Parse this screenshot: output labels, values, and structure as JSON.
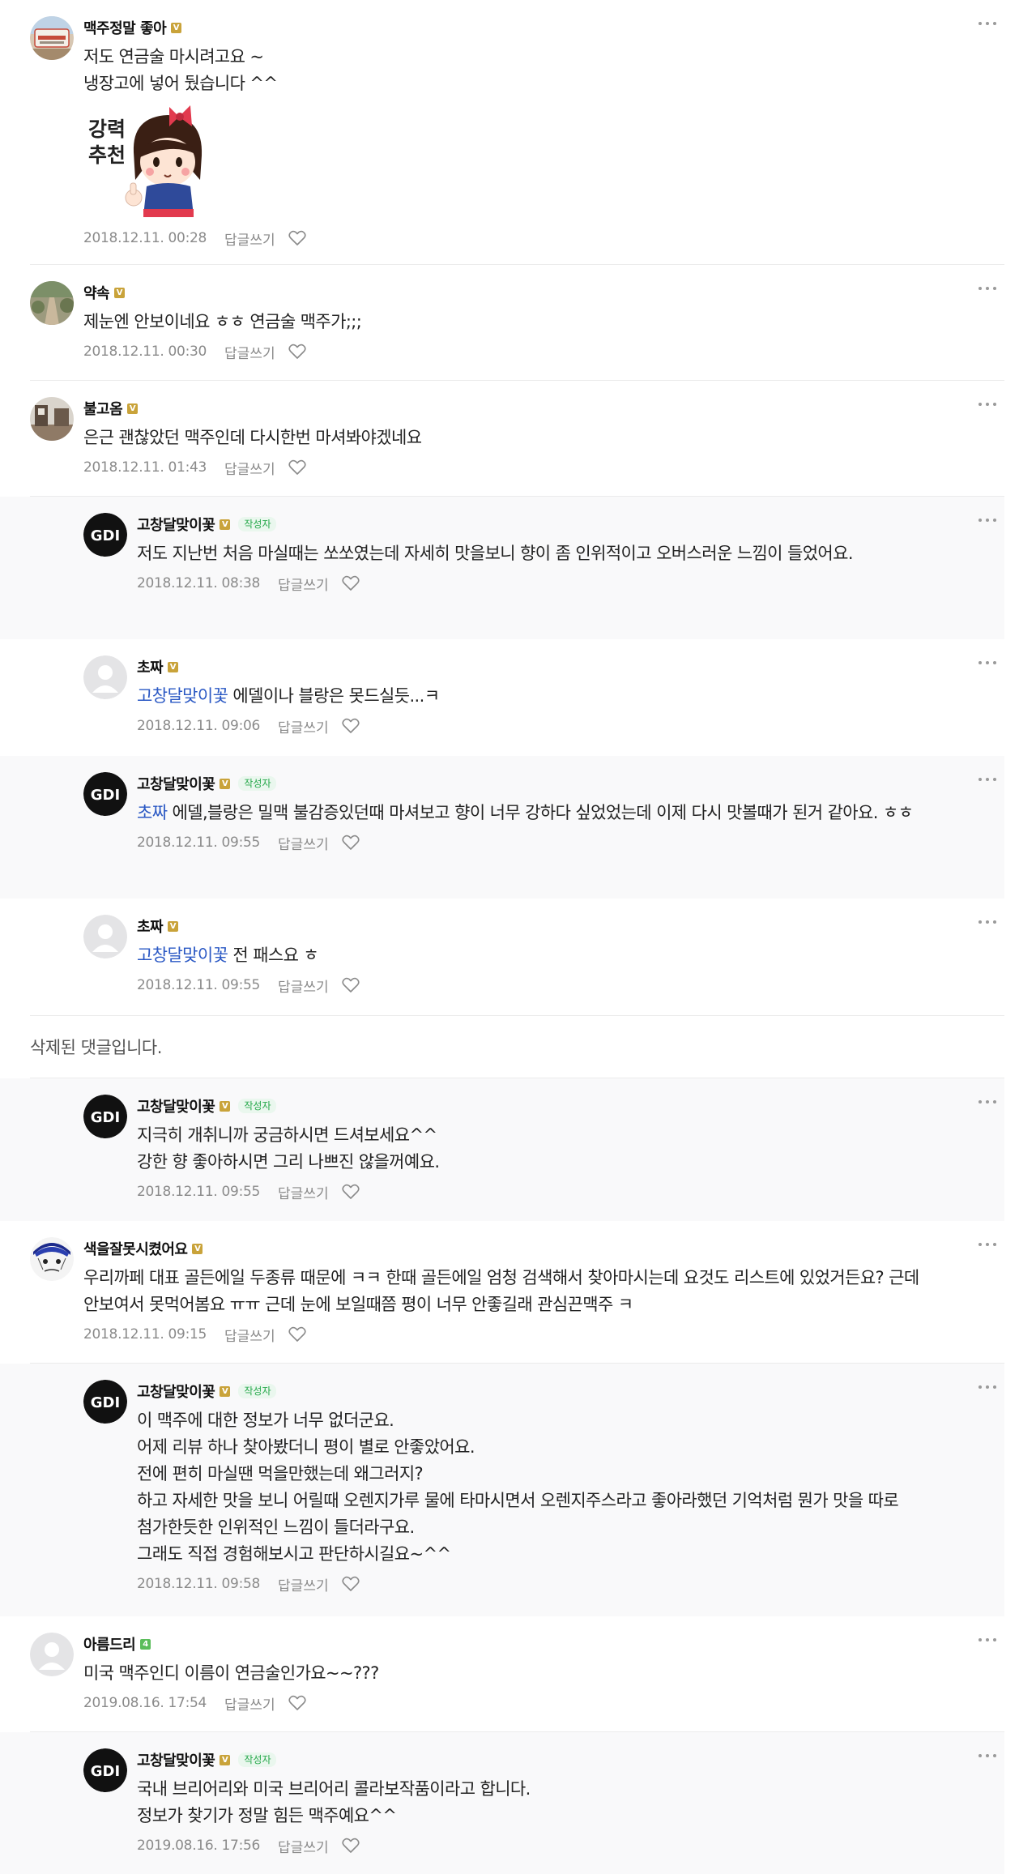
{
  "labels": {
    "reply": "답글쓰기",
    "author_badge": "작성자",
    "more_icon": "more-icon",
    "like_icon": "heart-icon"
  },
  "colors": {
    "grade_gold": "#c9a33a",
    "grade_green": "#5bbd5b",
    "mention": "#2a58c4",
    "reply_bg": "#f9f9fa",
    "author_badge": "#25a84a"
  },
  "sticker": {
    "text_line1": "강력",
    "text_line2": "추천"
  },
  "comments": [
    {
      "nick": "맥주정말 좋아",
      "grade": "V",
      "text": "저도 연금술 마시려고요 ~\n냉장고에 넣어 뒀습니다 ^^",
      "date": "2018.12.11. 00:28",
      "avatar": "brewery-sign"
    },
    {
      "nick": "약속",
      "grade": "V",
      "text": "제눈엔 안보이네요 ㅎㅎ 연금술 맥주가;;;",
      "date": "2018.12.11. 00:30",
      "avatar": "path-photo"
    },
    {
      "nick": "불고옴",
      "grade": "V",
      "text": "은근 괜찮았던 맥주인데 다시한번 마셔봐야겠네요",
      "date": "2018.12.11. 01:43",
      "avatar": "room-photo"
    },
    {
      "nick": "고창달맞이꽃",
      "grade": "V",
      "author": true,
      "text": "저도 지난번 처음 마실때는 쏘쏘였는데 자세히 맛을보니 향이 좀 인위적이고 오버스러운 느낌이 들었어요.",
      "date": "2018.12.11. 08:38",
      "avatar": "logo"
    },
    {
      "nick": "초짜",
      "grade": "V",
      "mention": "고창달맞이꽃",
      "text": " 에델이나 블랑은 못드실듯...ㅋ",
      "date": "2018.12.11. 09:06",
      "avatar": "default"
    },
    {
      "nick": "고창달맞이꽃",
      "grade": "V",
      "author": true,
      "mention": "초짜",
      "text": " 에델,블랑은 밀맥 불감증있던때 마셔보고 향이 너무 강하다 싶었었는데 이제 다시 맛볼때가 된거 같아요. ㅎㅎ",
      "date": "2018.12.11. 09:55",
      "avatar": "logo"
    },
    {
      "nick": "초짜",
      "grade": "V",
      "mention": "고창달맞이꽃",
      "text": " 전 패스요 ㅎ",
      "date": "2018.12.11. 09:55",
      "avatar": "default"
    },
    {
      "deleted_text": "삭제된 댓글입니다."
    },
    {
      "nick": "고창달맞이꽃",
      "grade": "V",
      "author": true,
      "text": "지극히 개취니까 궁금하시면 드셔보세요^^\n강한 향 좋아하시면 그리 나쁘진 않을꺼예요.",
      "date": "2018.12.11. 09:55",
      "avatar": "logo"
    },
    {
      "nick": "색을잘못시켰어요",
      "grade": "V",
      "text": "우리까페 대표 골든에일 두종류 때문에 ㅋㅋ 한때 골든에일 엄청 검색해서 찾아마시는데 요것도 리스트에 있었거든요? 근데 안보여서 못먹어봄요 ㅠㅠ 근데 눈에 보일때쯤 평이 너무 안좋길래 관심끈맥주 ㅋ",
      "date": "2018.12.11. 09:15",
      "avatar": "cartoon"
    },
    {
      "nick": "고창달맞이꽃",
      "grade": "V",
      "author": true,
      "text": "이 맥주에 대한 정보가 너무 없더군요.\n어제 리뷰 하나 찾아봤더니 평이 별로 안좋았어요.\n전에 편히 마실땐 먹을만했는데 왜그러지?\n하고 자세한 맛을 보니 어릴때 오렌지가루 물에 타마시면서 오렌지주스라고 좋아라했던 기억처럼 뭔가 맛을 따로 첨가한듯한 인위적인 느낌이 들더라구요.\n그래도 직접 경험해보시고 판단하시길요~^^",
      "date": "2018.12.11. 09:58",
      "avatar": "logo"
    },
    {
      "nick": "아름드리",
      "grade": "4",
      "text": "미국 맥주인디 이름이 연금술인가요~~???",
      "date": "2019.08.16. 17:54",
      "avatar": "default"
    },
    {
      "nick": "고창달맞이꽃",
      "grade": "V",
      "author": true,
      "text": "국내 브리어리와 미국 브리어리 콜라보작품이라고 합니다.\n정보가 찾기가 정말 힘든 맥주예요^^",
      "date": "2019.08.16. 17:56",
      "avatar": "logo"
    }
  ]
}
